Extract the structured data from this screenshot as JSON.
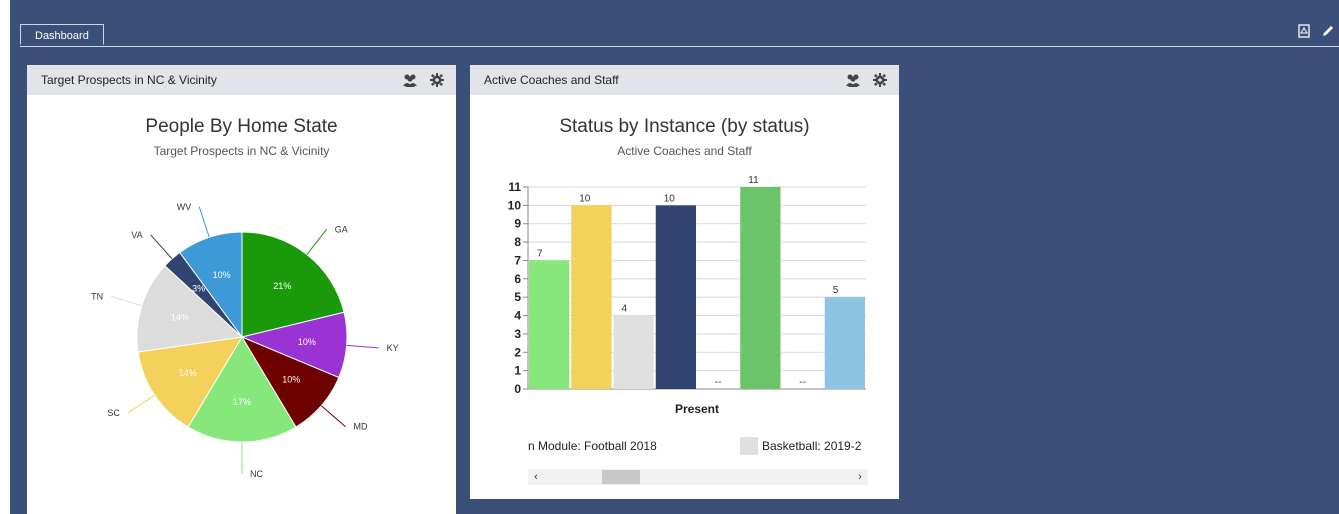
{
  "tabs": [
    {
      "label": "Dashboard"
    }
  ],
  "panels": [
    {
      "title": "Target Prospects in NC & Vicinity",
      "chart_title": "People By Home State",
      "chart_subtitle": "Target Prospects in NC & Vicinity"
    },
    {
      "title": "Active Coaches and Staff",
      "chart_title": "Status by Instance (by status)",
      "chart_subtitle": "Active Coaches and Staff",
      "legend_items": [
        "n Module: Football 2018",
        "Basketball: 2019-2"
      ]
    }
  ],
  "chart_data": [
    {
      "type": "pie",
      "title": "People By Home State",
      "subtitle": "Target Prospects in NC & Vicinity",
      "slices": [
        {
          "label": "GA",
          "value": 21,
          "value_label": "21%",
          "color": "#1a9a0a"
        },
        {
          "label": "KY",
          "value": 10,
          "value_label": "10%",
          "color": "#9b32d4"
        },
        {
          "label": "MD",
          "value": 10,
          "value_label": "10%",
          "color": "#6e0000"
        },
        {
          "label": "NC",
          "value": 17,
          "value_label": "17%",
          "color": "#86e87a"
        },
        {
          "label": "SC",
          "value": 14,
          "value_label": "14%",
          "color": "#f3d15b"
        },
        {
          "label": "TN",
          "value": 14,
          "value_label": "14%",
          "color": "#dcdcdc"
        },
        {
          "label": "VA",
          "value": 3,
          "value_label": "3%",
          "color": "#2f4470"
        },
        {
          "label": "WV",
          "value": 10,
          "value_label": "10%",
          "color": "#3e9ad6"
        }
      ]
    },
    {
      "type": "bar",
      "title": "Status by Instance (by status)",
      "subtitle": "Active Coaches and Staff",
      "categories": [
        "Present"
      ],
      "xlabel": "Present",
      "ylim": [
        0,
        11
      ],
      "yticks": [
        "0",
        "1",
        "2",
        "3",
        "4",
        "5",
        "6",
        "7",
        "8",
        "9",
        "10",
        "11"
      ],
      "bars": [
        {
          "value": 7,
          "label": "7",
          "color": "#86e87a"
        },
        {
          "value": 10,
          "label": "10",
          "color": "#f3d15b"
        },
        {
          "value": 4,
          "label": "4",
          "color": "#e0e0e0"
        },
        {
          "value": 10,
          "label": "10",
          "color": "#2f4470"
        },
        {
          "value": 0,
          "label": "--",
          "color": "#e0e0e0"
        },
        {
          "value": 11,
          "label": "11",
          "color": "#6cc46a"
        },
        {
          "value": 0,
          "label": "--",
          "color": "#e0e0e0"
        },
        {
          "value": 5,
          "label": "5",
          "color": "#8cc4e2"
        }
      ]
    }
  ],
  "icons": {
    "pdf": "pdf-icon",
    "edit": "pencil-icon",
    "group": "users-icon",
    "settings": "gear-icon"
  }
}
